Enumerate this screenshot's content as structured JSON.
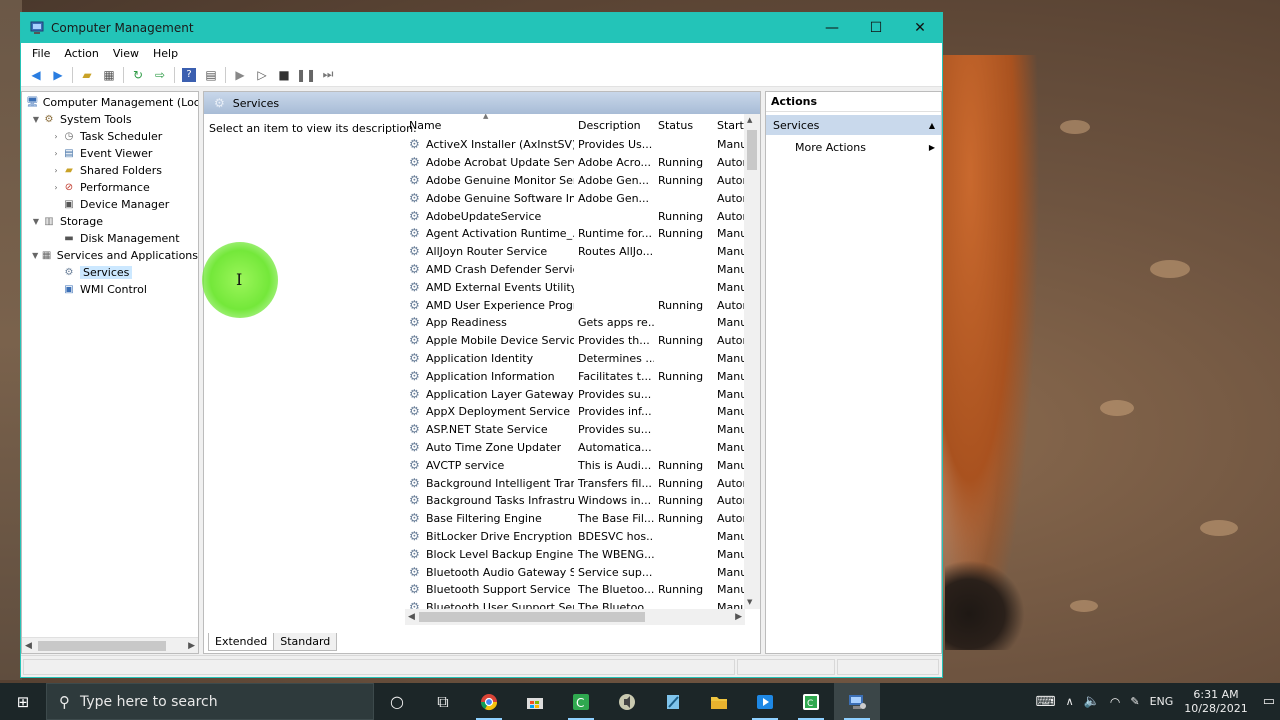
{
  "window": {
    "title": "Computer Management",
    "controls": {
      "minimize": "—",
      "maximize": "☐",
      "close": "✕"
    }
  },
  "menu": [
    "File",
    "Action",
    "View",
    "Help"
  ],
  "tree": {
    "items": [
      {
        "label": "Computer Management (Local",
        "level": 0,
        "arrow": "",
        "icon": "computer-icon",
        "glyph": "🖥"
      },
      {
        "label": "System Tools",
        "level": 1,
        "arrow": "▼",
        "icon": "system-tools-icon",
        "glyph": "⚙"
      },
      {
        "label": "Task Scheduler",
        "level": 2,
        "arrow": "›",
        "icon": "clock-icon",
        "glyph": "◷"
      },
      {
        "label": "Event Viewer",
        "level": 2,
        "arrow": "›",
        "icon": "event-viewer-icon",
        "glyph": "▤"
      },
      {
        "label": "Shared Folders",
        "level": 2,
        "arrow": "›",
        "icon": "folder-icon",
        "glyph": "▰"
      },
      {
        "label": "Performance",
        "level": 2,
        "arrow": "›",
        "icon": "performance-icon",
        "glyph": "⊘"
      },
      {
        "label": "Device Manager",
        "level": 2,
        "arrow": "",
        "icon": "device-manager-icon",
        "glyph": "▣"
      },
      {
        "label": "Storage",
        "level": 1,
        "arrow": "▼",
        "icon": "storage-icon",
        "glyph": "▥"
      },
      {
        "label": "Disk Management",
        "level": 2,
        "arrow": "",
        "icon": "disk-icon",
        "glyph": "▬"
      },
      {
        "label": "Services and Applications",
        "level": 1,
        "arrow": "▼",
        "icon": "services-apps-icon",
        "glyph": "▦"
      },
      {
        "label": "Services",
        "level": 2,
        "arrow": "",
        "icon": "gear-icon",
        "glyph": "⚙",
        "selected": true
      },
      {
        "label": "WMI Control",
        "level": 2,
        "arrow": "",
        "icon": "wmi-icon",
        "glyph": "▣"
      }
    ]
  },
  "center": {
    "header": "Services",
    "description_hint": "Select an item to view its description.",
    "columns": [
      "Name",
      "Description",
      "Status",
      "Startu"
    ],
    "rows": [
      [
        "ActiveX Installer (AxInstSV)",
        "Provides Us...",
        "",
        "Manu"
      ],
      [
        "Adobe Acrobat Update Serv...",
        "Adobe Acro...",
        "Running",
        "Autor"
      ],
      [
        "Adobe Genuine Monitor Ser...",
        "Adobe Gen...",
        "Running",
        "Autor"
      ],
      [
        "Adobe Genuine Software In...",
        "Adobe Gen...",
        "",
        "Autor"
      ],
      [
        "AdobeUpdateService",
        "",
        "Running",
        "Autor"
      ],
      [
        "Agent Activation Runtime_...",
        "Runtime for...",
        "Running",
        "Manu"
      ],
      [
        "AllJoyn Router Service",
        "Routes AllJo...",
        "",
        "Manu"
      ],
      [
        "AMD Crash Defender Service",
        "",
        "",
        "Manu"
      ],
      [
        "AMD External Events Utility",
        "",
        "",
        "Manu"
      ],
      [
        "AMD User Experience Progr...",
        "",
        "Running",
        "Autor"
      ],
      [
        "App Readiness",
        "Gets apps re...",
        "",
        "Manu"
      ],
      [
        "Apple Mobile Device Service",
        "Provides th...",
        "Running",
        "Autor"
      ],
      [
        "Application Identity",
        "Determines ...",
        "",
        "Manu"
      ],
      [
        "Application Information",
        "Facilitates t...",
        "Running",
        "Manu"
      ],
      [
        "Application Layer Gateway ...",
        "Provides su...",
        "",
        "Manu"
      ],
      [
        "AppX Deployment Service (...",
        "Provides inf...",
        "",
        "Manu"
      ],
      [
        "ASP.NET State Service",
        "Provides su...",
        "",
        "Manu"
      ],
      [
        "Auto Time Zone Updater",
        "Automatica...",
        "",
        "Manu"
      ],
      [
        "AVCTP service",
        "This is Audi...",
        "Running",
        "Manu"
      ],
      [
        "Background Intelligent Tran...",
        "Transfers fil...",
        "Running",
        "Autor"
      ],
      [
        "Background Tasks Infrastruc...",
        "Windows in...",
        "Running",
        "Autor"
      ],
      [
        "Base Filtering Engine",
        "The Base Fil...",
        "Running",
        "Autor"
      ],
      [
        "BitLocker Drive Encryption ...",
        "BDESVC hos...",
        "",
        "Manu"
      ],
      [
        "Block Level Backup Engine ...",
        "The WBENG...",
        "",
        "Manu"
      ],
      [
        "Bluetooth Audio Gateway S...",
        "Service sup...",
        "",
        "Manu"
      ],
      [
        "Bluetooth Support Service",
        "The Bluetoo...",
        "Running",
        "Manu"
      ],
      [
        "Bluetooth User Support Ser...",
        "The Bluetoo...",
        "",
        "Manu"
      ]
    ],
    "tabs": [
      "Extended",
      "Standard"
    ]
  },
  "actions": {
    "title": "Actions",
    "section": "Services",
    "items": [
      "More Actions"
    ]
  },
  "taskbar": {
    "search_placeholder": "Type here to search",
    "apps": [
      "cortana-icon",
      "task-view-icon",
      "chrome-icon",
      "store-icon",
      "camtasia-icon",
      "audio-app-icon",
      "notepad-icon",
      "file-explorer-icon",
      "media-icon",
      "camtasia-recorder-icon",
      "computer-management-icon"
    ],
    "language": "ENG",
    "time": "6:31 AM",
    "date": "10/28/2021"
  },
  "colors": {
    "titlebar": "#23c4b8",
    "selection": "#cce8ff",
    "section_header": "#c9d9ec",
    "taskbar": "#1c2628"
  }
}
